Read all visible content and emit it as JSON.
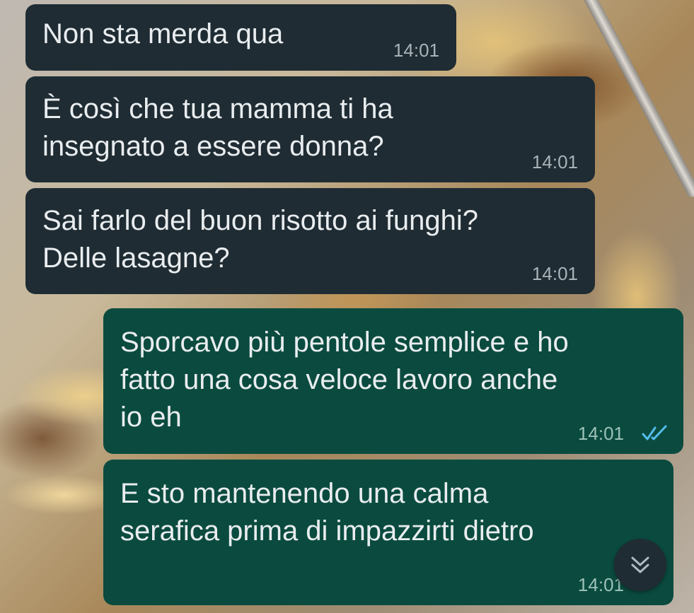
{
  "colors": {
    "incoming_bubble": "#1f2c33",
    "outgoing_bubble": "#0b4b3f",
    "text": "#e9edef",
    "read_ticks": "#53bdeb"
  },
  "messages": [
    {
      "direction": "incoming",
      "text": "Non sta merda qua",
      "time": "14:01"
    },
    {
      "direction": "incoming",
      "text": "È così che tua mamma ti ha\ninsegnato a essere donna?",
      "time": "14:01"
    },
    {
      "direction": "incoming",
      "text": "Sai farlo del buon risotto ai funghi?\nDelle lasagne?",
      "time": "14:01"
    },
    {
      "direction": "outgoing",
      "text": "Sporcavo più pentole semplice e ho\nfatto una cosa veloce lavoro anche\nio eh",
      "time": "14:01",
      "status_icon": "double-check-read-icon"
    },
    {
      "direction": "outgoing",
      "text": "E sto mantenendo una calma\nserafica prima di impazzirti dietro",
      "time": "14:01"
    }
  ],
  "scroll_button": {
    "icon": "double-chevron-down-icon"
  }
}
